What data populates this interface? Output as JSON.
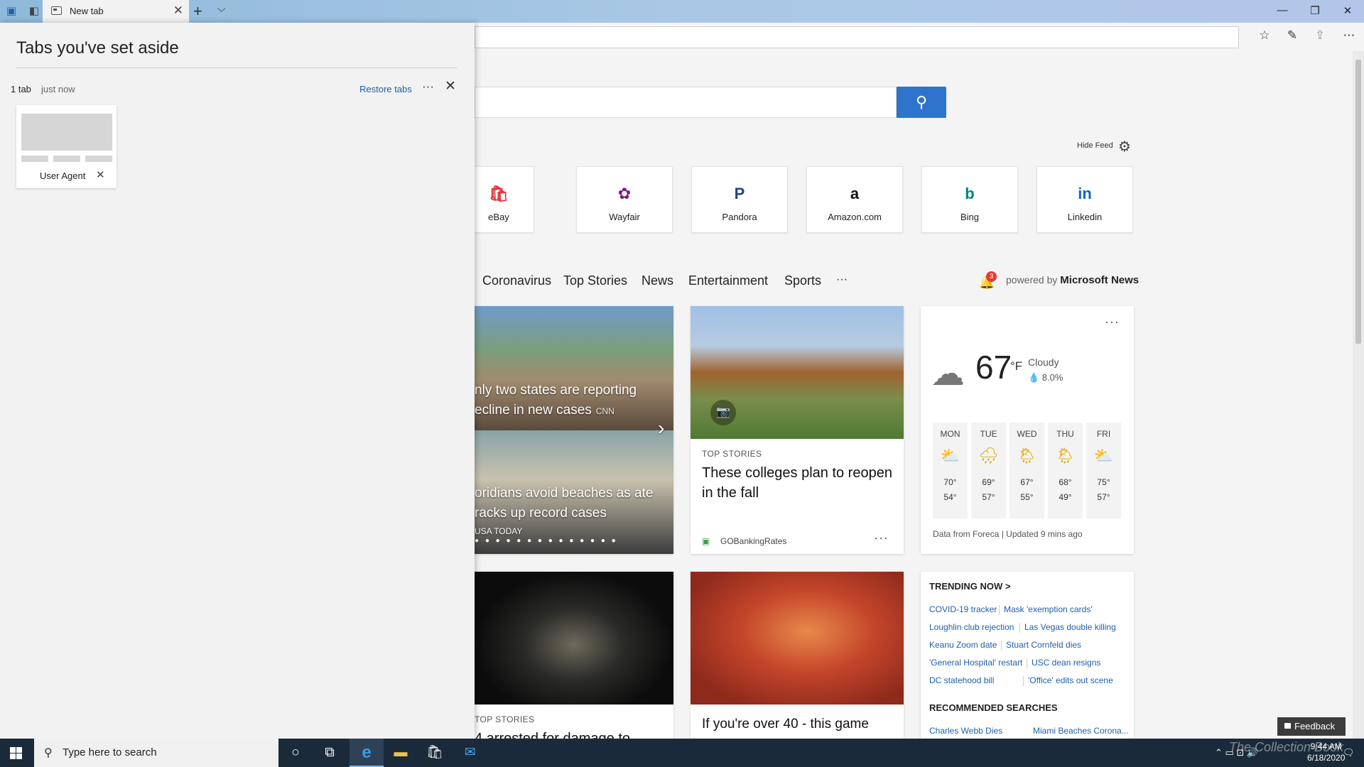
{
  "titlebar": {
    "tab_title": "New tab",
    "tab_close": "✕",
    "new_tab": "+",
    "tab_list": "⌵",
    "minimize": "—",
    "maximize": "❐",
    "close": "✕"
  },
  "toolbar": {
    "favorites_icon": "☆",
    "notes_icon": "✎",
    "share_icon": "⇪",
    "more_icon": "⋯"
  },
  "search": {
    "button_icon": "⚲"
  },
  "feed": {
    "hide_label": "Hide Feed",
    "gear": "⚙"
  },
  "top_sites": [
    {
      "name": "eBay",
      "color": "#e53238",
      "glyph": "🛍"
    },
    {
      "name": "Wayfair",
      "color": "#7f187f",
      "glyph": "✿"
    },
    {
      "name": "Pandora",
      "color": "#224099",
      "glyph": "P"
    },
    {
      "name": "Amazon.com",
      "color": "#111111",
      "glyph": "a"
    },
    {
      "name": "Bing",
      "color": "#008373",
      "glyph": "b"
    },
    {
      "name": "Linkedin",
      "color": "#0a66c2",
      "glyph": "in"
    }
  ],
  "news_nav": {
    "items": [
      "Coronavirus",
      "Top Stories",
      "News",
      "Entertainment",
      "Sports"
    ],
    "more": "···",
    "bell": "🔔",
    "badge": "3",
    "powered_prefix": "powered by ",
    "powered_brand": "Microsoft News"
  },
  "cards": {
    "carousel": {
      "headline1": "nly two states are reporting ecline in new cases",
      "source1": "CNN",
      "headline2": "oridians avoid beaches as ate racks up record cases",
      "source2": "USA TODAY",
      "next": "›",
      "dots": "● ● ● ● ● ● ● ● ● ● ● ● ● ●"
    },
    "college": {
      "label": "TOP STORIES",
      "headline": "These colleges plan to reopen in the fall",
      "source": "GOBankingRates",
      "more": "···",
      "camera": "📷"
    },
    "whitehouse": {
      "label": "TOP STORIES",
      "headline": "4 arrested for damage to"
    },
    "game": {
      "headline": "If you're over 40 - this game"
    }
  },
  "weather": {
    "more": "···",
    "temp": "67",
    "unit": "°F",
    "condition": "Cloudy",
    "rain": "💧 8.0%",
    "cloud_icon": "☁",
    "days": [
      {
        "name": "MON",
        "icon": "⛅",
        "high": "70°",
        "low": "54°"
      },
      {
        "name": "TUE",
        "icon": "🌧",
        "high": "69°",
        "low": "57°"
      },
      {
        "name": "WED",
        "icon": "🌦",
        "high": "67°",
        "low": "55°"
      },
      {
        "name": "THU",
        "icon": "🌦",
        "high": "68°",
        "low": "49°"
      },
      {
        "name": "FRI",
        "icon": "⛅",
        "high": "75°",
        "low": "57°"
      }
    ],
    "footer": "Data from Foreca | Updated 9 mins ago"
  },
  "trending": {
    "title": "TRENDING NOW >",
    "rows": [
      [
        "COVID-19 tracker",
        "Mask 'exemption cards'"
      ],
      [
        "Loughlin club rejection",
        "Las Vegas double killing"
      ],
      [
        "Keanu Zoom date",
        "Stuart Cornfeld dies"
      ],
      [
        "'General Hospital' restart",
        "USC dean resigns"
      ],
      [
        "DC statehood bill",
        "'Office' edits out scene"
      ]
    ],
    "recommended_title": "RECOMMENDED SEARCHES",
    "recommended": [
      "Charles Webb Dies",
      "Miami Beaches Corona..."
    ]
  },
  "feedback": "Feedback",
  "panel": {
    "title": "Tabs you've set aside",
    "count": "1 tab",
    "time": "just now",
    "restore": "Restore tabs",
    "more": "···",
    "close": "✕",
    "tab_name": "User Agent",
    "tab_close": "✕"
  },
  "taskbar": {
    "search_text": "Type here to search",
    "search_icon": "⚲",
    "cortana": "○",
    "taskview": "⧉",
    "edge": "e",
    "explorer": "▬",
    "store": "🛍",
    "mail": "✉",
    "tray": "⌃  ▭  ⊡  🔊",
    "time": "9:44 AM",
    "date": "6/18/2020",
    "notif": "🗨",
    "watermark": "The Collection Book"
  }
}
